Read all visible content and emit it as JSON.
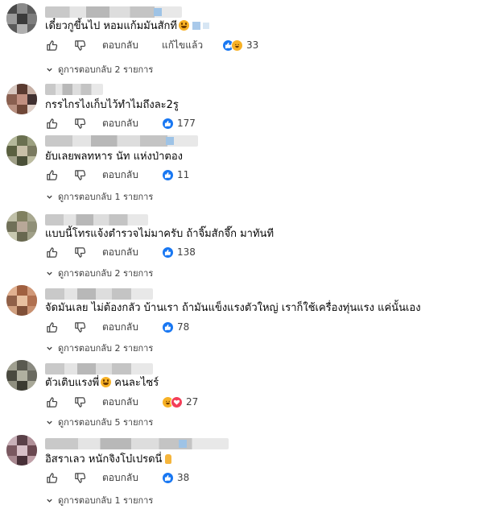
{
  "comments": [
    {
      "text": "เดี๋ยวกูขึ้นไป หอมแก้มมันสักที",
      "reply_label": "ตอบกลับ",
      "edited_label": "แก้ไขแล้ว",
      "reaction_count": "33",
      "replies_label": "ดูการตอบกลับ 2 รายการ",
      "reactions": [
        "like-icon",
        "haha-icon"
      ]
    },
    {
      "text": "กรรไกรไงเก็บไว้ทำไมถึงละ2รู",
      "reply_label": "ตอบกลับ",
      "reaction_count": "177",
      "reactions": [
        "like-icon"
      ]
    },
    {
      "text": "ยับเลยพลทหาร นัท แห่งป่าตอง",
      "reply_label": "ตอบกลับ",
      "reaction_count": "11",
      "replies_label": "ดูการตอบกลับ 1 รายการ",
      "reactions": [
        "like-icon"
      ]
    },
    {
      "text": "แบบนี้โทรแจ้งตำรวจไม่มาครับ ถ้าจิ๊มสักจึ๊ก มาทันที",
      "reply_label": "ตอบกลับ",
      "reaction_count": "138",
      "replies_label": "ดูการตอบกลับ 2 รายการ",
      "reactions": [
        "like-icon"
      ]
    },
    {
      "text": "จัดมันเลย ไม่ต้องกลัว บ้านเรา ถ้ามันแข็งแรงตัวใหญ่ เราก็ใช้เครื่องทุ่นแรง แค่นั้นเอง",
      "reply_label": "ตอบกลับ",
      "reaction_count": "78",
      "replies_label": "ดูการตอบกลับ 2 รายการ",
      "reactions": [
        "like-icon"
      ]
    },
    {
      "text": "ตัวเติบแรงพี่",
      "text_after": " คนละไซร์",
      "reply_label": "ตอบกลับ",
      "reaction_count": "27",
      "replies_label": "ดูการตอบกลับ 5 รายการ",
      "reactions": [
        "haha-icon",
        "love-icon"
      ]
    },
    {
      "text": "อิสราเลว หนักจิงโบ๋เปรดนี่",
      "reply_label": "ตอบกลับ",
      "reaction_count": "38",
      "replies_label": "ดูการตอบกลับ 1 รายการ",
      "reactions": [
        "like-icon"
      ]
    }
  ],
  "colors": {
    "like": "#1877f2",
    "haha": "#f7b125",
    "love": "#f33e58",
    "text": "#050505",
    "muted": "#404040"
  }
}
